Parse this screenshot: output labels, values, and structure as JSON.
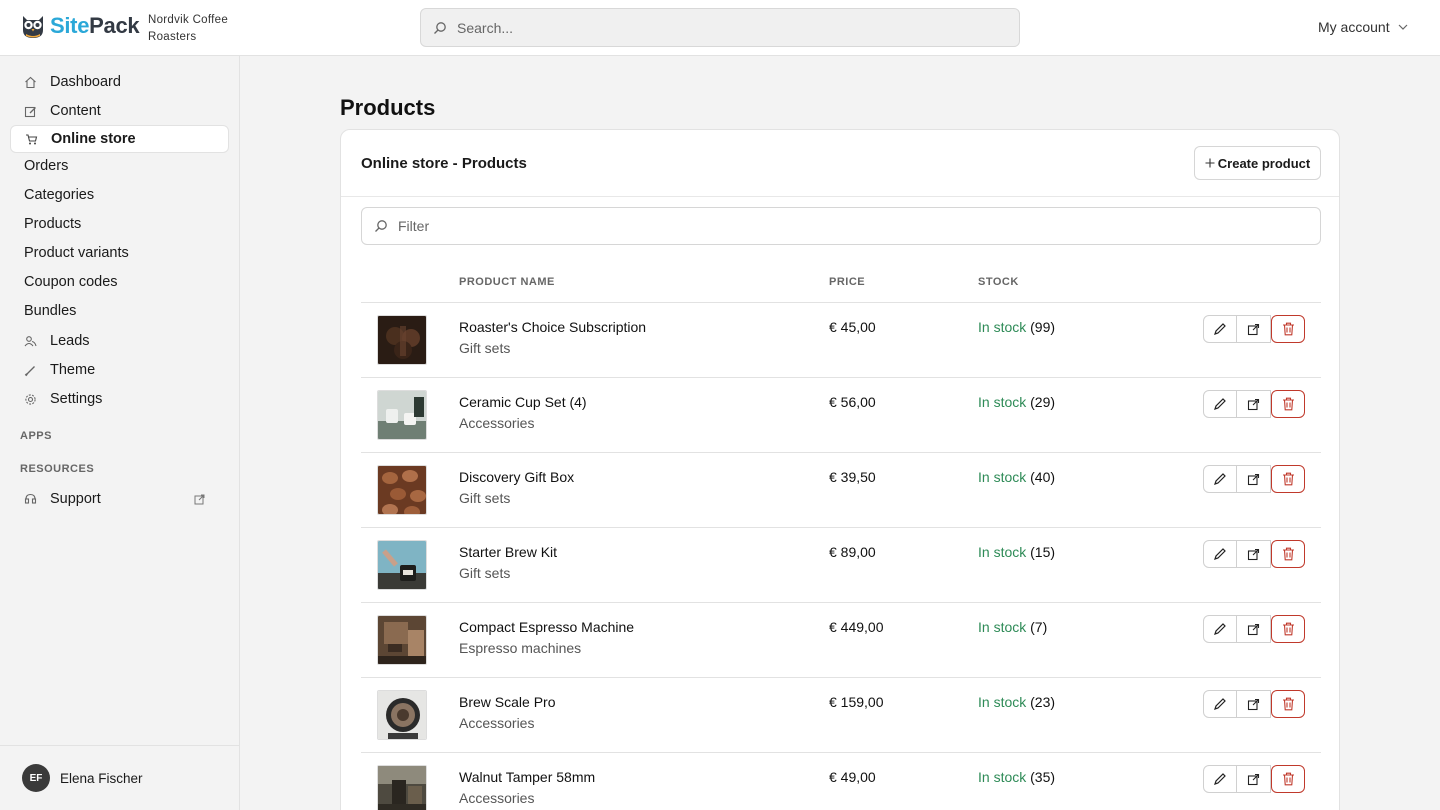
{
  "header": {
    "brand_site": "Site",
    "brand_pack": "Pack",
    "org_name": "Nordvik Coffee Roasters",
    "search_placeholder": "Search...",
    "account_label": "My account"
  },
  "sidebar": {
    "items": [
      {
        "label": "Dashboard",
        "icon": "home-icon"
      },
      {
        "label": "Content",
        "icon": "edit-icon"
      },
      {
        "label": "Online store",
        "icon": "cart-icon",
        "active": true
      }
    ],
    "subitems": [
      "Orders",
      "Categories",
      "Products",
      "Product variants",
      "Coupon codes",
      "Bundles"
    ],
    "items_bottom": [
      {
        "label": "Leads",
        "icon": "users-icon"
      },
      {
        "label": "Theme",
        "icon": "brush-icon"
      },
      {
        "label": "Settings",
        "icon": "gear-icon"
      }
    ],
    "section_apps": "APPS",
    "section_resources": "RESOURCES",
    "support_label": "Support",
    "user": {
      "initials": "EF",
      "name": "Elena Fischer"
    }
  },
  "main": {
    "page_title": "Products",
    "card_title": "Online store - Products",
    "create_label": "Create product",
    "filter_placeholder": "Filter",
    "columns": [
      "PRODUCT NAME",
      "PRICE",
      "STOCK"
    ],
    "stock_label": "In stock",
    "rows": [
      {
        "name": "Roaster's Choice Subscription",
        "category": "Gift sets",
        "price": "€ 45,00",
        "stock": "(99)"
      },
      {
        "name": "Ceramic Cup Set (4)",
        "category": "Accessories",
        "price": "€ 56,00",
        "stock": "(29)"
      },
      {
        "name": "Discovery Gift Box",
        "category": "Gift sets",
        "price": "€ 39,50",
        "stock": "(40)"
      },
      {
        "name": "Starter Brew Kit",
        "category": "Gift sets",
        "price": "€ 89,00",
        "stock": "(15)"
      },
      {
        "name": "Compact Espresso Machine",
        "category": "Espresso machines",
        "price": "€ 449,00",
        "stock": "(7)"
      },
      {
        "name": "Brew Scale Pro",
        "category": "Accessories",
        "price": "€ 159,00",
        "stock": "(23)"
      },
      {
        "name": "Walnut Tamper 58mm",
        "category": "Accessories",
        "price": "€ 49,00",
        "stock": "(35)"
      }
    ]
  },
  "colors": {
    "brand_blue": "#2ba8d8",
    "in_stock": "#2e8b57",
    "delete": "#c0392b"
  }
}
